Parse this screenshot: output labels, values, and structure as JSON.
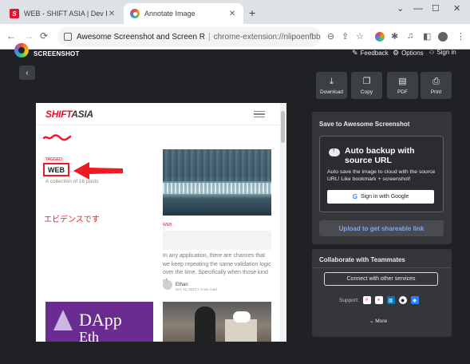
{
  "browser": {
    "tabs": [
      {
        "title": "WEB - SHIFT ASIA | Dev Blog",
        "favicon": "shift-asia-icon",
        "active": false
      },
      {
        "title": "Annotate Image",
        "favicon": "awesome-screenshot-icon",
        "active": true
      }
    ],
    "new_tab_glyph": "+",
    "window_controls": {
      "chevron": "⌄",
      "minimize": "—",
      "maximize": "☐",
      "close": "✕"
    },
    "nav": {
      "back": "←",
      "forward": "→",
      "reload": "⟳"
    },
    "address": {
      "page_title": "Awesome Screenshot and Screen R",
      "separator": "|",
      "url": "chrome-extension://nlipoenfbbikpbjkfpfil..."
    },
    "toolbar_icons": {
      "zoom": "⊖",
      "share": "⇪",
      "bookmark": "☆",
      "extensions": "✱",
      "media": "♫",
      "sidepanel": "◧",
      "menu": "⋮"
    }
  },
  "app": {
    "brand": {
      "line1": "AWESOME",
      "line2": "SCREENSHOT"
    },
    "header_links": [
      {
        "label": "Feedback",
        "icon": "✎"
      },
      {
        "label": "Options",
        "icon": "⚙"
      },
      {
        "label": "Sign in",
        "icon": "👤"
      }
    ],
    "back_glyph": "‹"
  },
  "canvas": {
    "site_logo_red": "SHIFT",
    "site_logo_dark": "ASIA",
    "tagged_label": "TAGGED",
    "tag_name": "WEB",
    "collection_text": "A collection of 16 posts",
    "annotation_text": "エビデンスです",
    "annotation_color": "#ee1b24",
    "post": {
      "category": "WEB",
      "excerpt": "In any application, there are chances that we keep repeating the same validation logic over the time. Specifically when those kind of...",
      "author": "Ethan",
      "date": "Dec 11, 2021 • 4 min read"
    },
    "dapp_image": {
      "line1": "DApp",
      "line2": "Eth"
    }
  },
  "actions": [
    {
      "label": "Download",
      "icon": "⤓"
    },
    {
      "label": "Copy",
      "icon": "❐"
    },
    {
      "label": "PDF",
      "icon": "▤"
    },
    {
      "label": "Print",
      "icon": "⎙"
    }
  ],
  "save_panel": {
    "title": "Save to Awesome Screenshot",
    "backup_title": "Auto backup with source URL",
    "backup_desc": "Auto save the image to cloud with the source URL! Like bookmark + screenshot!",
    "google_g": "G",
    "signin_google": "Sign in with Google",
    "upload_label": "Upload to get shareable link"
  },
  "collab_panel": {
    "title": "Collaborate with Teammates",
    "connect_label": "Connect with other services",
    "support_label": "Support:",
    "services": [
      {
        "name": "slack",
        "glyph": "#"
      },
      {
        "name": "asana",
        "glyph": "●"
      },
      {
        "name": "trello",
        "glyph": "▥"
      },
      {
        "name": "github",
        "glyph": "◉"
      },
      {
        "name": "jira",
        "glyph": "◆"
      }
    ],
    "more_label": "⌄  More"
  },
  "colors": {
    "app_bg": "#202124",
    "panel_bg": "#35363a",
    "accent_link": "#7aa7f5",
    "brand_red": "#e8112d"
  }
}
